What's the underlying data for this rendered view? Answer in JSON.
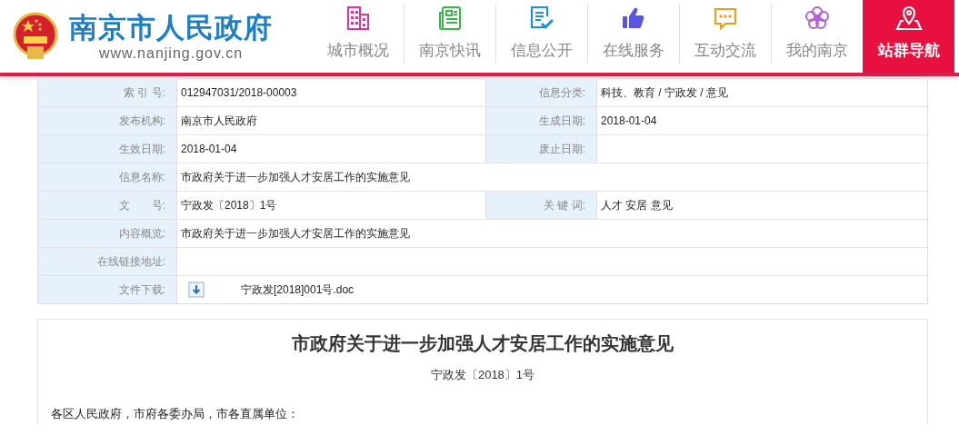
{
  "site": {
    "name": "南京市人民政府",
    "url": "www.nanjing.gov.cn"
  },
  "nav": [
    {
      "label": "城市概况",
      "kind": "building",
      "color": "#d6359d",
      "selected": false
    },
    {
      "label": "南京快讯",
      "kind": "news",
      "color": "#3bb54a",
      "selected": false
    },
    {
      "label": "信息公开",
      "kind": "doc",
      "color": "#1e90d6",
      "selected": false
    },
    {
      "label": "在线服务",
      "kind": "thumb",
      "color": "#5a55e0",
      "selected": false
    },
    {
      "label": "互动交流",
      "kind": "chat",
      "color": "#e8a020",
      "selected": false
    },
    {
      "label": "我的南京",
      "kind": "flower",
      "color": "#b560d0",
      "selected": false
    },
    {
      "label": "站群导航",
      "kind": "pin",
      "color": "#ffffff",
      "selected": true
    }
  ],
  "info_table": [
    {
      "fields": [
        {
          "label": "索 引 号:",
          "value": "012947031/2018-00003"
        },
        {
          "label": "信息分类:",
          "value": "科技、教育 / 宁政发 / 意见"
        }
      ]
    },
    {
      "fields": [
        {
          "label": "发布机构:",
          "value": "南京市人民政府"
        },
        {
          "label": "生成日期:",
          "value": "2018-01-04"
        }
      ]
    },
    {
      "fields": [
        {
          "label": "生效日期:",
          "value": "2018-01-04"
        },
        {
          "label": "废止日期:"
        }
      ]
    },
    {
      "fields": [
        {
          "label": "信息名称:",
          "value": "市政府关于进一步加强人才安居工作的实施意见"
        }
      ]
    },
    {
      "fields": [
        {
          "label": "文　　号:",
          "value": "宁政发〔2018〕1号"
        },
        {
          "label": "关 键 词:",
          "value": "人才 安居 意见"
        }
      ]
    },
    {
      "fields": [
        {
          "label": "内容概览:",
          "value": "市政府关于进一步加强人才安居工作的实施意见"
        }
      ]
    },
    {
      "fields": [
        {
          "label": "在线链接地址:"
        }
      ]
    },
    {
      "fields": [
        {
          "label": "文件下载:",
          "file": "宁政发[2018]001号.doc"
        }
      ]
    }
  ],
  "article": {
    "title": "市政府关于进一步加强人才安居工作的实施意见",
    "doc_number": "宁政发〔2018〕1号",
    "salutation": "各区人民政府，市府各委办局，市各直属单位："
  }
}
